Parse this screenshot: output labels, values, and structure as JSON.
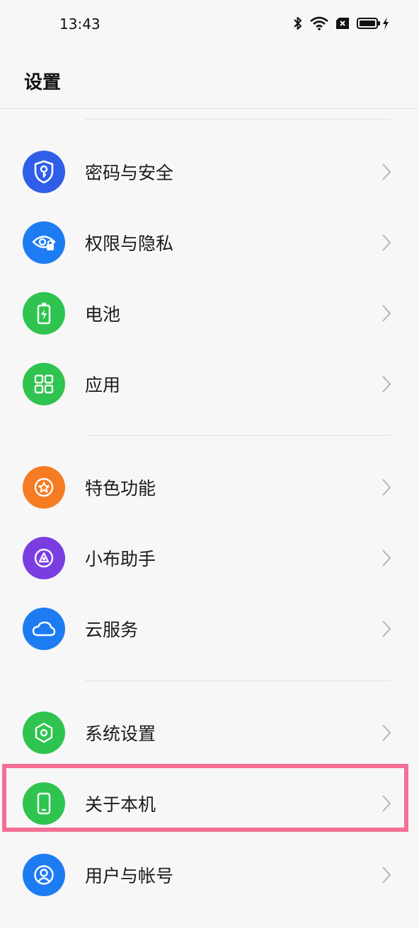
{
  "status_bar": {
    "time": "13:43",
    "icons": [
      "bluetooth-icon",
      "wifi-icon",
      "no-sim-icon",
      "battery-icon",
      "charging-icon"
    ]
  },
  "header": {
    "title": "设置"
  },
  "items": [
    {
      "label": "密码与安全",
      "icon": "shield-key-icon",
      "color": "#2f5fe8"
    },
    {
      "label": "权限与隐私",
      "icon": "eye-lock-icon",
      "color": "#1e7cf2"
    },
    {
      "label": "电池",
      "icon": "battery-charge-icon",
      "color": "#2ec44f"
    },
    {
      "label": "应用",
      "icon": "apps-grid-icon",
      "color": "#2ec44f"
    },
    {
      "label": "特色功能",
      "icon": "star-circle-icon",
      "color": "#f57c22"
    },
    {
      "label": "小布助手",
      "icon": "assistant-icon",
      "color": "#7a3ee0"
    },
    {
      "label": "云服务",
      "icon": "cloud-icon",
      "color": "#1e7cf2"
    },
    {
      "label": "系统设置",
      "icon": "hexagon-gear-icon",
      "color": "#2ec44f"
    },
    {
      "label": "关于本机",
      "icon": "phone-icon",
      "color": "#2ec44f"
    },
    {
      "label": "用户与帐号",
      "icon": "user-icon",
      "color": "#1e7cf2"
    }
  ],
  "highlight_color": "#f46f95"
}
